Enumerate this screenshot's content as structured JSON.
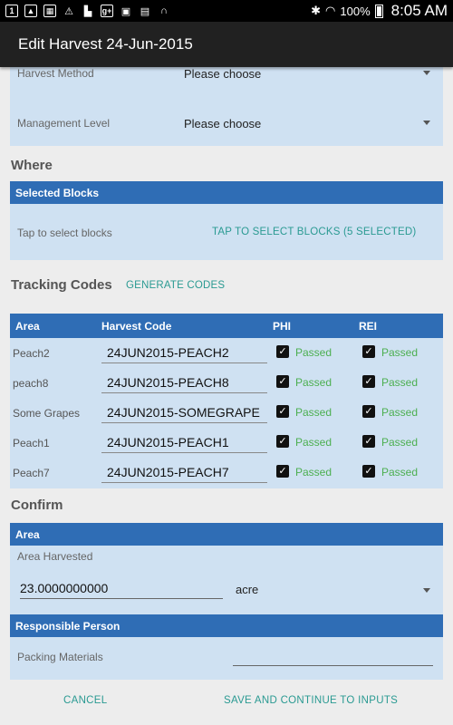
{
  "status_bar": {
    "left_icons": [
      "sim-icon",
      "image-icon",
      "calendar-icon",
      "warning-icon",
      "flipboard-icon",
      "google-plus-icon",
      "photo-icon",
      "briefcase-icon",
      "headphones-icon"
    ],
    "battery": "100%",
    "time": "8:05 AM"
  },
  "action_bar": {
    "title": "Edit Harvest 24-Jun-2015"
  },
  "harvest": {
    "method_label": "Harvest Method",
    "method_value": "Please choose",
    "management_label": "Management Level",
    "management_value": "Please choose"
  },
  "where": {
    "title": "Where",
    "panel_header": "Selected Blocks",
    "tap_label": "Tap to select blocks",
    "tap_button": "TAP TO SELECT BLOCKS (5 SELECTED)"
  },
  "tracking": {
    "title": "Tracking Codes",
    "generate_button": "GENERATE CODES",
    "columns": [
      "Area",
      "Harvest Code",
      "PHI",
      "REI"
    ],
    "rows": [
      {
        "area": "Peach2",
        "code": "24JUN2015-PEACH2",
        "phi": "Passed",
        "rei": "Passed"
      },
      {
        "area": "peach8",
        "code": "24JUN2015-PEACH8",
        "phi": "Passed",
        "rei": "Passed"
      },
      {
        "area": "Some Grapes",
        "code": "24JUN2015-SOMEGRAPE",
        "phi": "Passed",
        "rei": "Passed"
      },
      {
        "area": "Peach1",
        "code": "24JUN2015-PEACH1",
        "phi": "Passed",
        "rei": "Passed"
      },
      {
        "area": "Peach7",
        "code": "24JUN2015-PEACH7",
        "phi": "Passed",
        "rei": "Passed"
      }
    ]
  },
  "confirm": {
    "title": "Confirm",
    "area_header": "Area",
    "area_harvested_label": "Area Harvested",
    "area_value": "23.0000000000",
    "unit": "acre",
    "responsible_header": "Responsible Person",
    "packing_label": "Packing Materials",
    "packing_value": ""
  },
  "footer": {
    "cancel": "CANCEL",
    "save": "SAVE AND CONTINUE TO INPUTS"
  },
  "colors": {
    "header_blue": "#2f6db5",
    "panel_blue": "#cfe1f2",
    "accent_teal": "#2a9a92",
    "passed_green": "#4caf50"
  }
}
